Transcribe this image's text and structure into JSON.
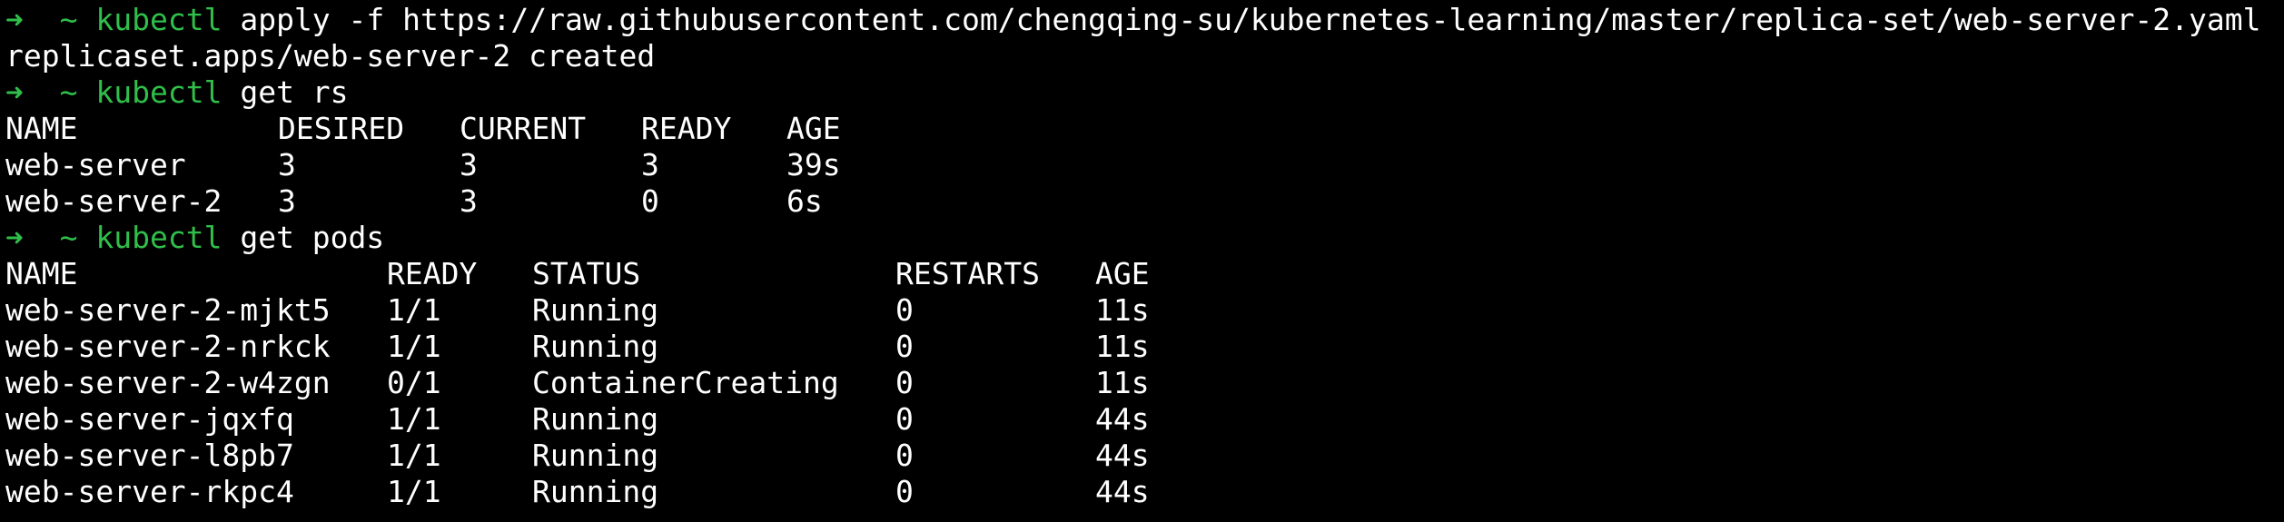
{
  "prompt": {
    "arrow": "➜",
    "dir": "~"
  },
  "commands": [
    {
      "name": "kubectl",
      "args": "apply -f https://raw.githubusercontent.com/chengqing-su/kubernetes-learning/master/replica-set/web-server-2.yaml",
      "output": "replicaset.apps/web-server-2 created"
    },
    {
      "name": "kubectl",
      "args": "get rs"
    },
    {
      "name": "kubectl",
      "args": "get pods"
    }
  ],
  "rs_table": {
    "headers": [
      "NAME",
      "DESIRED",
      "CURRENT",
      "READY",
      "AGE"
    ],
    "rows": [
      [
        "web-server",
        "3",
        "3",
        "3",
        "39s"
      ],
      [
        "web-server-2",
        "3",
        "3",
        "0",
        "6s"
      ]
    ]
  },
  "pods_table": {
    "headers": [
      "NAME",
      "READY",
      "STATUS",
      "RESTARTS",
      "AGE"
    ],
    "rows": [
      [
        "web-server-2-mjkt5",
        "1/1",
        "Running",
        "0",
        "11s"
      ],
      [
        "web-server-2-nrkck",
        "1/1",
        "Running",
        "0",
        "11s"
      ],
      [
        "web-server-2-w4zgn",
        "0/1",
        "ContainerCreating",
        "0",
        "11s"
      ],
      [
        "web-server-jqxfq",
        "1/1",
        "Running",
        "0",
        "44s"
      ],
      [
        "web-server-l8pb7",
        "1/1",
        "Running",
        "0",
        "44s"
      ],
      [
        "web-server-rkpc4",
        "1/1",
        "Running",
        "0",
        "44s"
      ]
    ]
  },
  "colors": {
    "background": "#000000",
    "prompt_green": "#2fbf4a",
    "text": "#ffffff"
  }
}
